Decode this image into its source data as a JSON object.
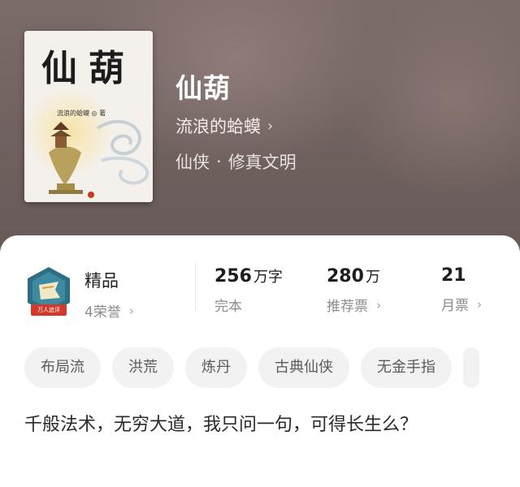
{
  "book": {
    "cover_title": "仙葫",
    "cover_author": "流浪的蛤蟆 ◎ 著",
    "title": "仙葫",
    "author": "流浪的蛤蟆",
    "category": "仙侠",
    "subcategory": "修真文明",
    "separator": "·"
  },
  "badge": {
    "text": "万人追评",
    "color": "#2f6f85"
  },
  "stats": {
    "quality_label": "精品",
    "honors": "4荣誉",
    "word_count_value": "256",
    "word_count_unit": "万字",
    "status": "完本",
    "recommend_value": "280",
    "recommend_unit": "万",
    "recommend_label": "推荐票",
    "monthly_value": "21",
    "monthly_label": "月票"
  },
  "tags": [
    "布局流",
    "洪荒",
    "炼丹",
    "古典仙侠",
    "无金手指"
  ],
  "synopsis": "千般法术，无穷大道，我只问一句，可得长生么？",
  "icons": {
    "chevron": "›"
  },
  "colors": {
    "header_bg": "#6e605d",
    "card_bg": "#ffffff",
    "tag_bg": "#f2f2f2",
    "badge_red": "#d2392b"
  }
}
